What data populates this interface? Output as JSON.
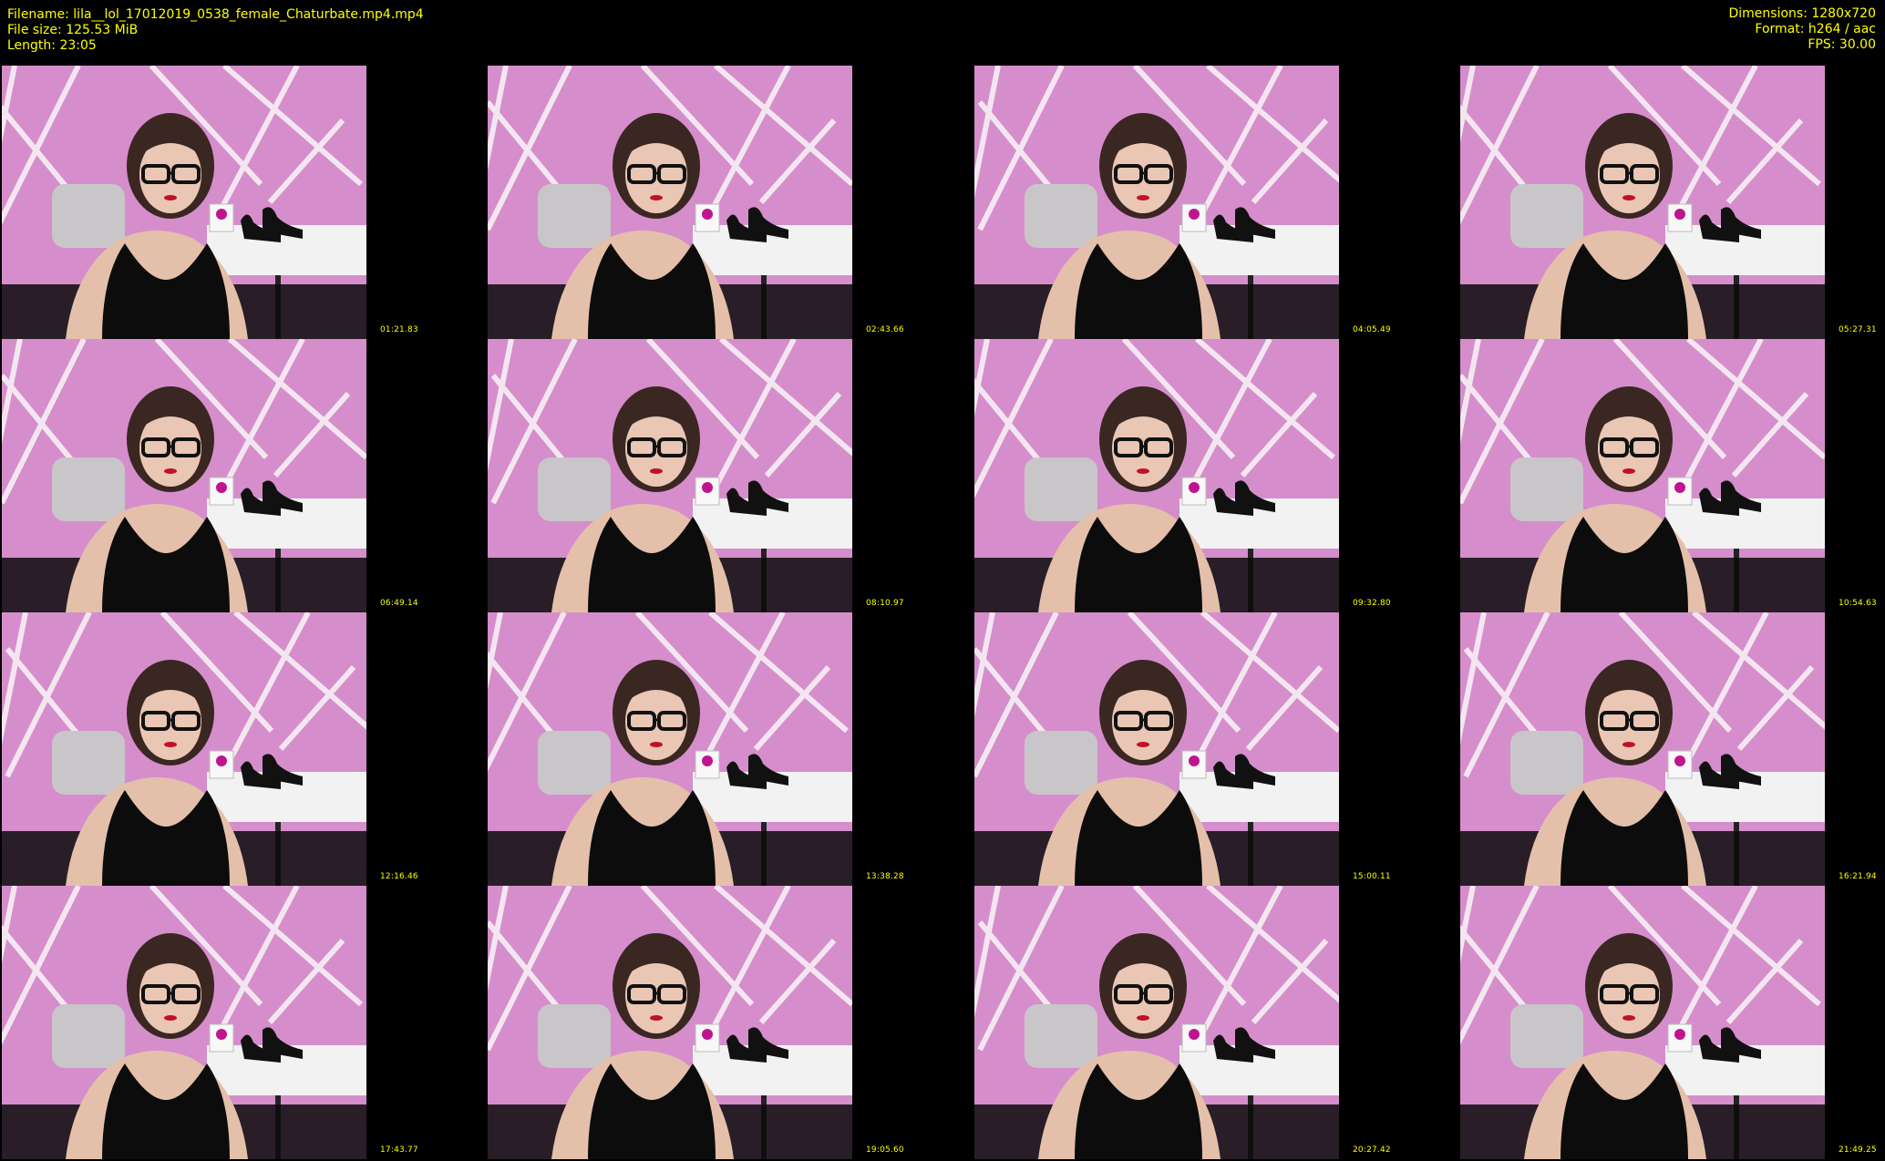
{
  "header": {
    "filename": "Filename: lila__lol_17012019_0538_female_Chaturbate.mp4.mp4",
    "file_size": "File size: 125.53 MiB",
    "length": "Length: 23:05",
    "dimensions": "Dimensions: 1280x720",
    "format": "Format: h264 / aac",
    "fps": "FPS: 30.00"
  },
  "colors": {
    "text": "#ffff00",
    "background": "#000000",
    "wall": "#d58ecb"
  },
  "thumbnails": [
    {
      "timestamp": "01:21.83"
    },
    {
      "timestamp": "02:43.66"
    },
    {
      "timestamp": "04:05.49"
    },
    {
      "timestamp": "05:27.31"
    },
    {
      "timestamp": "06:49.14"
    },
    {
      "timestamp": "08:10.97"
    },
    {
      "timestamp": "09:32.80"
    },
    {
      "timestamp": "10:54.63"
    },
    {
      "timestamp": "12:16.46"
    },
    {
      "timestamp": "13:38.28"
    },
    {
      "timestamp": "15:00.11"
    },
    {
      "timestamp": "16:21.94"
    },
    {
      "timestamp": "17:43.77"
    },
    {
      "timestamp": "19:05.60"
    },
    {
      "timestamp": "20:27.42"
    },
    {
      "timestamp": "21:49.25"
    }
  ]
}
